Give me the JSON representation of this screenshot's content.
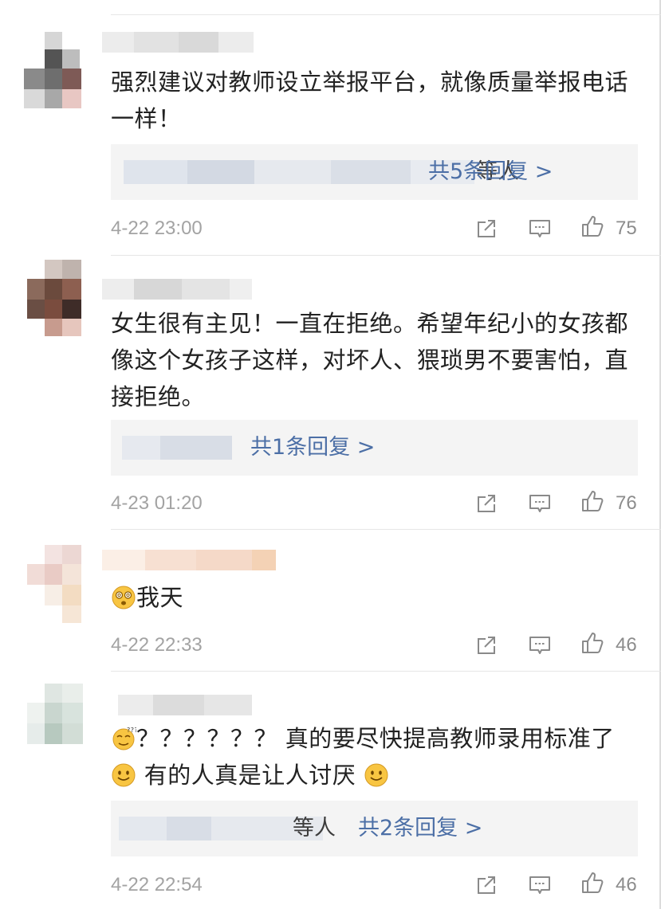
{
  "comments": [
    {
      "text": "强烈建议对教师设立举报平台，就像质量举报电话一样！",
      "reply_suffix": "等人",
      "reply_link": "共5条回复 >",
      "time": "4-22 23:00",
      "likes": "75"
    },
    {
      "text": "女生很有主见！一直在拒绝。希望年纪小的女孩都像这个女孩子这样，对坏人、猥琐男不要害怕，直接拒绝。",
      "reply_link": "共1条回复 >",
      "time": "4-23 01:20",
      "likes": "76"
    },
    {
      "text": "我天",
      "emoji_lead": "dizzy-face-emoji",
      "time": "4-22 22:33",
      "likes": "46"
    },
    {
      "text_line1": "？？？？？？ 真的要尽快提高教师录用标准了",
      "text_line2": "有的人真是让人讨厌",
      "emoji_lead": "confused-face-emoji",
      "emoji_smile": "smile-emoji",
      "reply_suffix": "等人",
      "reply_link": "共2条回复 >",
      "time": "4-22 22:54",
      "likes": "46"
    }
  ],
  "icons": {
    "share": "share-icon",
    "comment": "comment-icon",
    "like": "thumbs-up-icon"
  },
  "colors": {
    "link": "#4c6fa6",
    "meta": "#a3a3a3",
    "reply_bg": "#f4f4f4"
  }
}
